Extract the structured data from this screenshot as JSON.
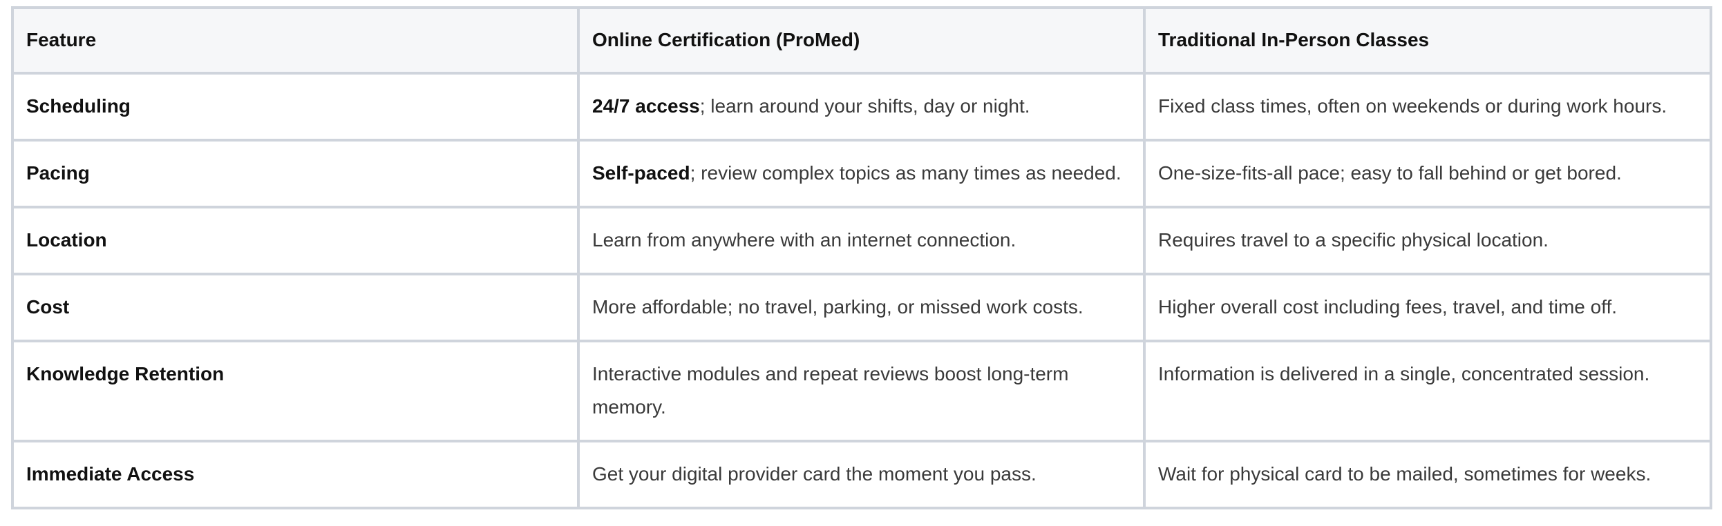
{
  "table": {
    "headers": [
      "Feature",
      "Online Certification (ProMed)",
      "Traditional In-Person Classes"
    ],
    "rows": [
      {
        "feature": "Scheduling",
        "online_lead": "24/7 access",
        "online_rest": "; learn around your shifts, day or night.",
        "traditional": "Fixed class times, often on weekends or during work hours."
      },
      {
        "feature": "Pacing",
        "online_lead": "Self-paced",
        "online_rest": "; review complex topics as many times as needed.",
        "traditional": "One-size-fits-all pace; easy to fall behind or get bored."
      },
      {
        "feature": "Location",
        "online_lead": "",
        "online_rest": "Learn from anywhere with an internet connection.",
        "traditional": "Requires travel to a specific physical location."
      },
      {
        "feature": "Cost",
        "online_lead": "",
        "online_rest": "More affordable; no travel, parking, or missed work costs.",
        "traditional": "Higher overall cost including fees, travel, and time off."
      },
      {
        "feature": "Knowledge Retention",
        "online_lead": "",
        "online_rest": "Interactive modules and repeat reviews boost long-term memory.",
        "traditional": "Information is delivered in a single, concentrated session."
      },
      {
        "feature": "Immediate Access",
        "online_lead": "",
        "online_rest": "Get your digital provider card the moment you pass.",
        "traditional": "Wait for physical card to be mailed, sometimes for weeks."
      }
    ]
  }
}
